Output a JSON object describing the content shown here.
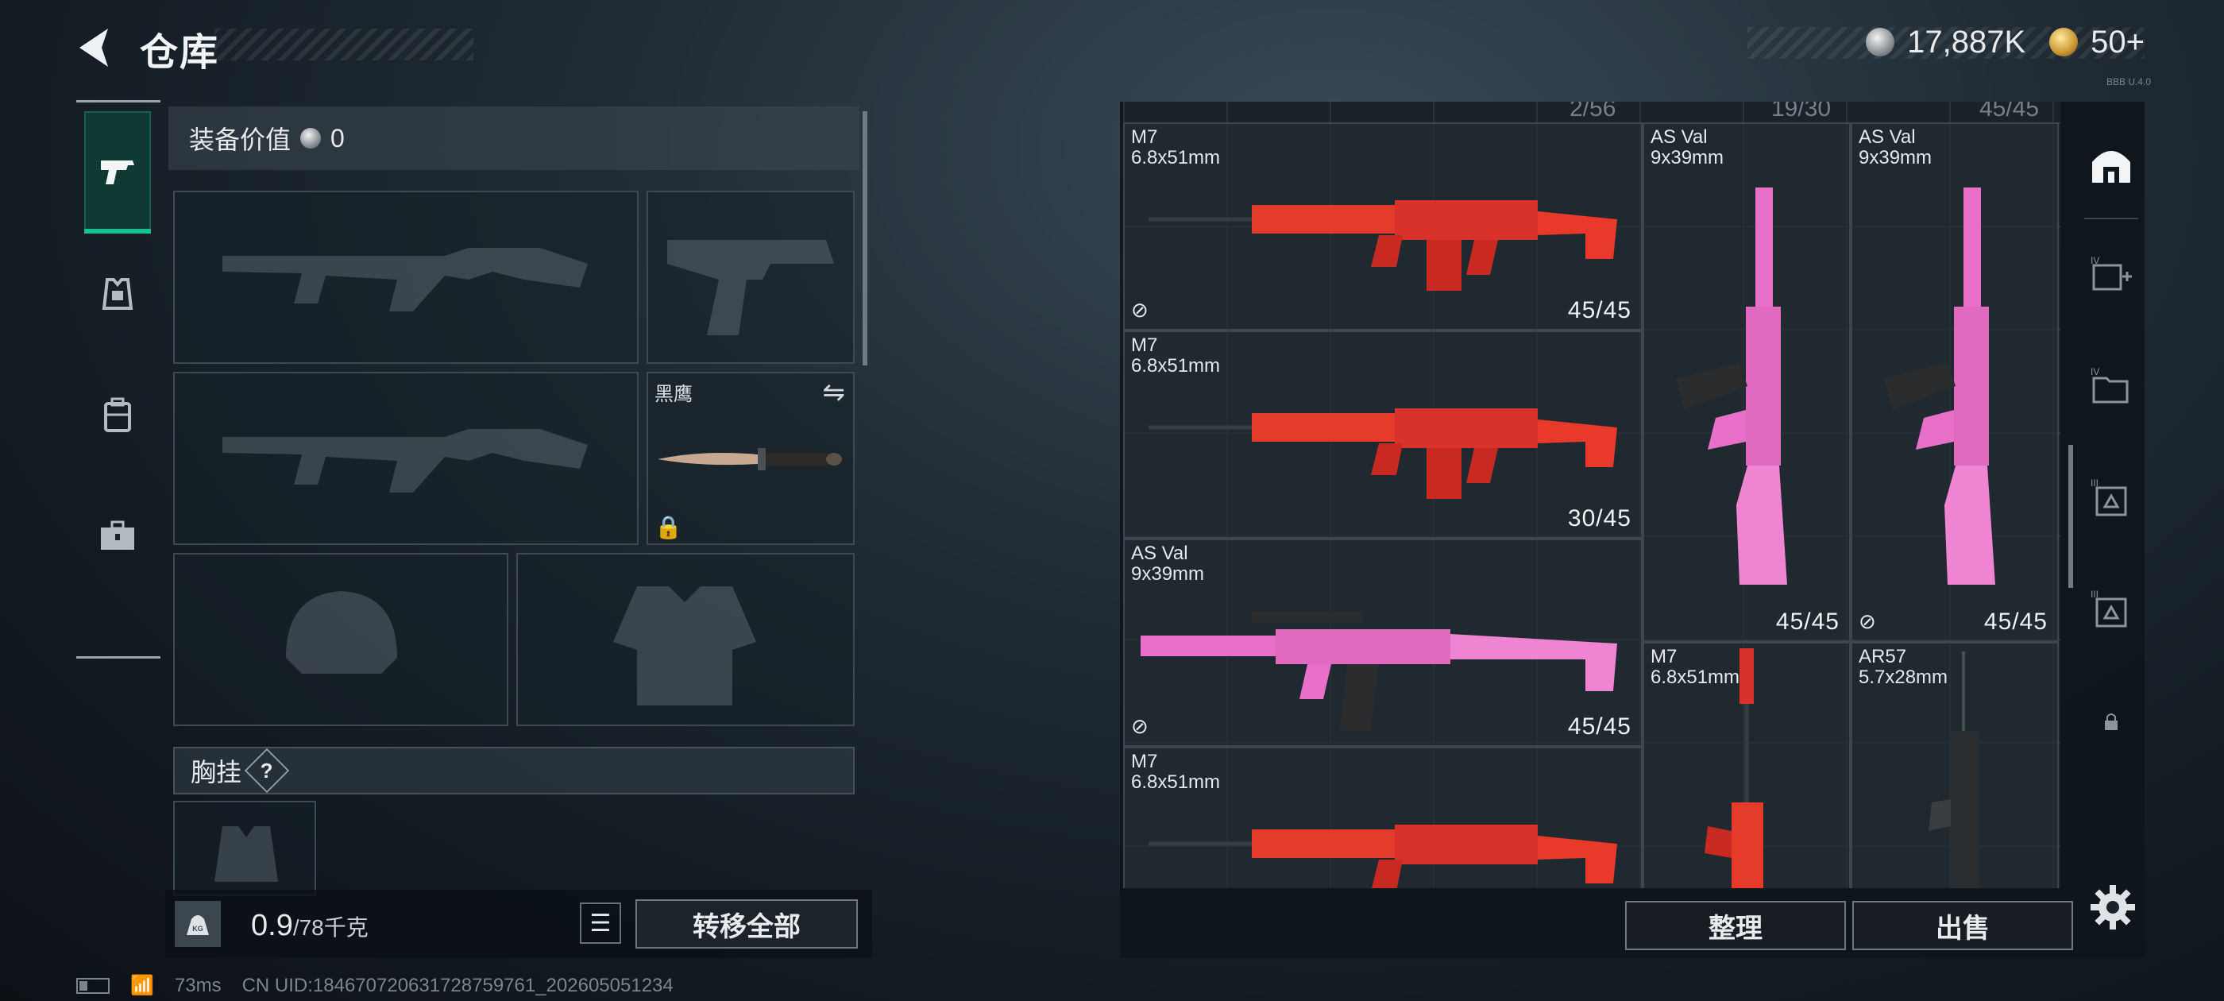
{
  "header": {
    "title": "仓库",
    "currency_silver": "17,887K",
    "currency_gold": "50+",
    "corner_tag": "BBB U.4.0"
  },
  "equipment": {
    "value_label": "装备价值",
    "value": "0",
    "knife_name": "黑鹰",
    "chest_rig_label": "胸挂",
    "chest_rig_help": "?"
  },
  "weight": {
    "current": "0.9",
    "capacity": "/78千克"
  },
  "buttons": {
    "transfer_all": "转移全部",
    "sort": "整理",
    "sell": "出售"
  },
  "storage": {
    "header_counts": [
      "2/56",
      "19/30",
      "45/45"
    ],
    "items": [
      {
        "name": "M7",
        "caliber": "6.8x51mm",
        "ammo": "45/45",
        "no_insurance": true,
        "color": "#e53b2b"
      },
      {
        "name": "M7",
        "caliber": "6.8x51mm",
        "ammo": "30/45",
        "no_insurance": false,
        "color": "#e53b2b"
      },
      {
        "name": "AS Val",
        "caliber": "9x39mm",
        "ammo": "45/45",
        "no_insurance": true,
        "color": "#e870c8"
      },
      {
        "name": "M7",
        "caliber": "6.8x51mm",
        "ammo": "",
        "no_insurance": false,
        "color": "#e53b2b"
      },
      {
        "name": "AS Val",
        "caliber": "9x39mm",
        "ammo": "45/45",
        "no_insurance": false,
        "color": "#e870c8"
      },
      {
        "name": "AS Val",
        "caliber": "9x39mm",
        "ammo": "45/45",
        "no_insurance": true,
        "color": "#e870c8"
      },
      {
        "name": "M7",
        "caliber": "6.8x51mm",
        "ammo": "",
        "no_insurance": false,
        "color": "#e53b2b"
      },
      {
        "name": "AR57",
        "caliber": "5.7x28mm",
        "ammo": "",
        "no_insurance": false,
        "color": "#2b2e31"
      }
    ]
  },
  "status": {
    "ping": "73ms",
    "uid": "CN UID:1846707206317287597­61_202605051234"
  }
}
